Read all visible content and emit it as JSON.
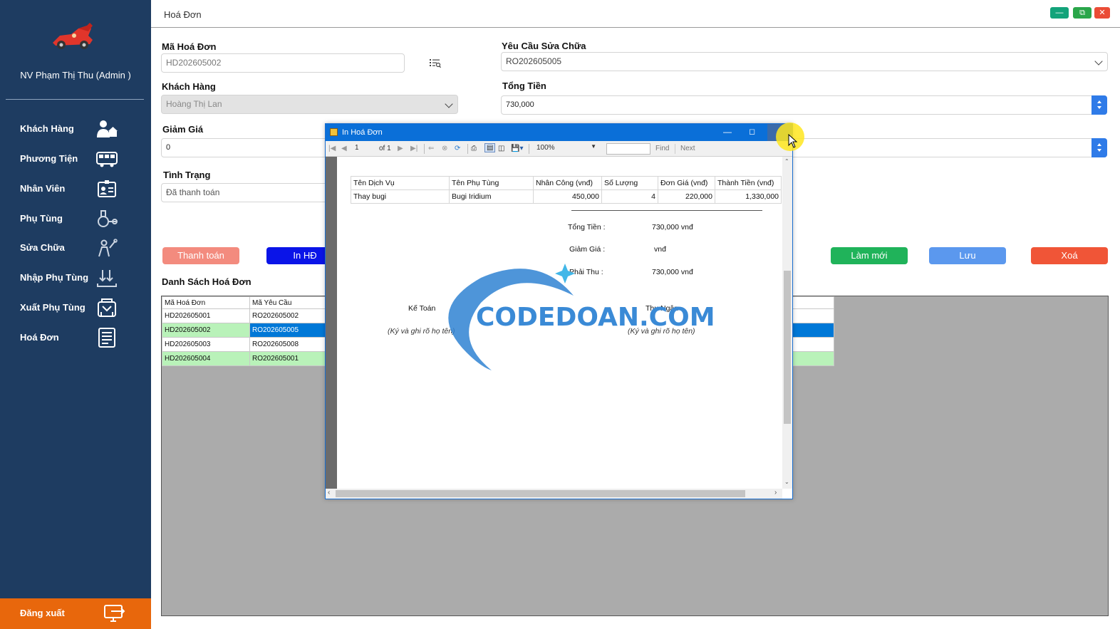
{
  "sidebar": {
    "user_name": "NV Phạm Thị Thu (Admin )",
    "items": [
      {
        "label": "Khách Hàng",
        "icon": "customer-icon"
      },
      {
        "label": "Phương Tiện",
        "icon": "bus-icon"
      },
      {
        "label": "Nhân Viên",
        "icon": "id-card-icon"
      },
      {
        "label": "Phụ Tùng",
        "icon": "spare-part-icon"
      },
      {
        "label": "Sửa Chữa",
        "icon": "mechanic-icon"
      },
      {
        "label": "Nhập Phụ Tùng",
        "icon": "import-icon"
      },
      {
        "label": "Xuất Phụ Tùng",
        "icon": "export-icon"
      },
      {
        "label": "Hoá Đơn",
        "icon": "invoice-icon"
      }
    ],
    "logout_label": "Đăng xuất"
  },
  "window": {
    "title": "Hoá Đơn"
  },
  "form": {
    "ma_hoa_don_label": "Mã Hoá Đơn",
    "ma_hoa_don_value": "HD202605002",
    "khach_hang_label": "Khách Hàng",
    "khach_hang_value": "Hoàng Thị Lan",
    "giam_gia_label": "Giảm Giá",
    "giam_gia_value": "0",
    "tinh_trang_label": "Tình Trạng",
    "tinh_trang_value": "Đã thanh toán",
    "yeu_cau_label": "Yêu Cầu Sửa Chữa",
    "yeu_cau_value": "RO202605005",
    "tong_tien_label": "Tổng Tiền",
    "tong_tien_value": "730,000"
  },
  "buttons": {
    "thanh_toan": "Thanh toán",
    "in_hd": "In HĐ",
    "lam_moi": "Làm mới",
    "luu": "Lưu",
    "xoa": "Xoá"
  },
  "list": {
    "title": "Danh Sách Hoá Đơn",
    "columns": [
      "Mã Hoá Đơn",
      "Mã Yêu Cầu"
    ],
    "rows": [
      [
        "HD202605001",
        "RO202605002"
      ],
      [
        "HD202605002",
        "RO202605005"
      ],
      [
        "HD202605003",
        "RO202605008"
      ],
      [
        "HD202605004",
        "RO202605001"
      ]
    ]
  },
  "dialog": {
    "title": "In Hoá Đơn",
    "toolbar": {
      "page": "1",
      "of_label": "of 1",
      "zoom": "100%",
      "find": "Find",
      "next": "Next"
    },
    "report": {
      "columns": [
        "Tên Dịch Vụ",
        "Tên Phụ Tùng",
        "Nhân Công (vnđ)",
        "Số Lượng",
        "Đơn Giá (vnđ)",
        "Thành Tiền (vnđ)"
      ],
      "row": [
        "Thay bugi",
        "Bugi Iridium",
        "450,000",
        "4",
        "220,000",
        "1,330,000"
      ],
      "tong_tien_label": "Tổng Tiền :",
      "tong_tien_value": "730,000 vnđ",
      "giam_gia_label": "Giảm Giá :",
      "giam_gia_value": "vnđ",
      "phai_thu_label": "Phải Thu :",
      "phai_thu_value": "730,000 vnđ",
      "ke_toan": "Kế Toán",
      "thu_ngan": "Thu Ngân",
      "sign_note_left": "(Ký và ghi rõ họ tên)",
      "sign_note_right": "(Ký và ghi rõ họ tên)"
    }
  },
  "watermark": {
    "text": "CODEDOAN.COM"
  },
  "colors": {
    "sidebar_bg": "#1e3c61",
    "logout_bg": "#e8670c",
    "thanh_toan": "#f38b7e",
    "in_hd": "#0a14e8",
    "lam_moi": "#20b35a",
    "luu": "#5b98ee",
    "xoa": "#f05537",
    "row_alt": "#b9f2b9",
    "selection": "#0078d7"
  }
}
